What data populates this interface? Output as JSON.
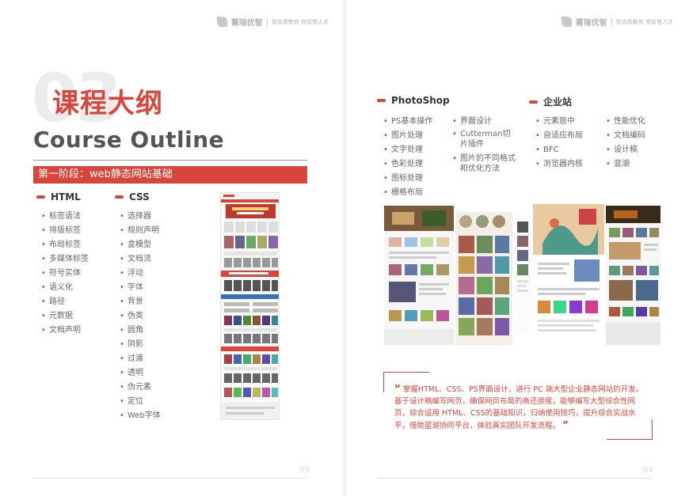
{
  "brand": {
    "name": "菁瑞优智",
    "slogan": "锐优质教育·育智慧人才"
  },
  "left": {
    "big_num": "03",
    "title_cn": "课程大纲",
    "title_en": "Course Outline",
    "stage": "第一阶段：web静态网站基础",
    "html": {
      "heading": "HTML",
      "items": [
        "标签语法",
        "排版标签",
        "布局标签",
        "多媒体标签",
        "符号实体",
        "语义化",
        "路径",
        "元数据",
        "文档声明"
      ]
    },
    "css": {
      "heading": "CSS",
      "items": [
        "选择器",
        "规则声明",
        "盒模型",
        "文档流",
        "浮动",
        "字体",
        "背景",
        "伪类",
        "圆角",
        "阴影",
        "过渡",
        "透明",
        "伪元素",
        "定位",
        "Web字体"
      ]
    },
    "page_num": "03"
  },
  "right": {
    "photoshop": {
      "heading": "PhotoShop",
      "col1": [
        "PS基本操作",
        "图片处理",
        "文字处理",
        "色彩处理",
        "图标处理",
        "栅格布局"
      ],
      "col2": [
        "界面设计",
        "Cutterman切片插件",
        "图片的不同格式和优化方法"
      ]
    },
    "enterprise": {
      "heading": "企业站",
      "col1": [
        "元素居中",
        "自适应布局",
        "BFC",
        "浏览器内核"
      ],
      "col2": [
        "性能优化",
        "文档编码",
        "设计稿",
        "蓝湖"
      ]
    },
    "quote_open": "“",
    "quote_close": "”",
    "quote": "掌握HTML、CSS、PS界面设计，进行 PC 端大型企业静态网站的开发。基于设计稿编写网页，确保网页布局的高还原度，能够编写大型综合性网页，综合运用 HTML、CSS的基础知识，归纳使用技巧，提升综合实战水平，借助蓝湖协同平台，体验真实团队开发流程。",
    "page_num": "04"
  },
  "colors": {
    "accent": "#d9453a",
    "title_gray": "#555555",
    "watermark": "#ececec"
  }
}
